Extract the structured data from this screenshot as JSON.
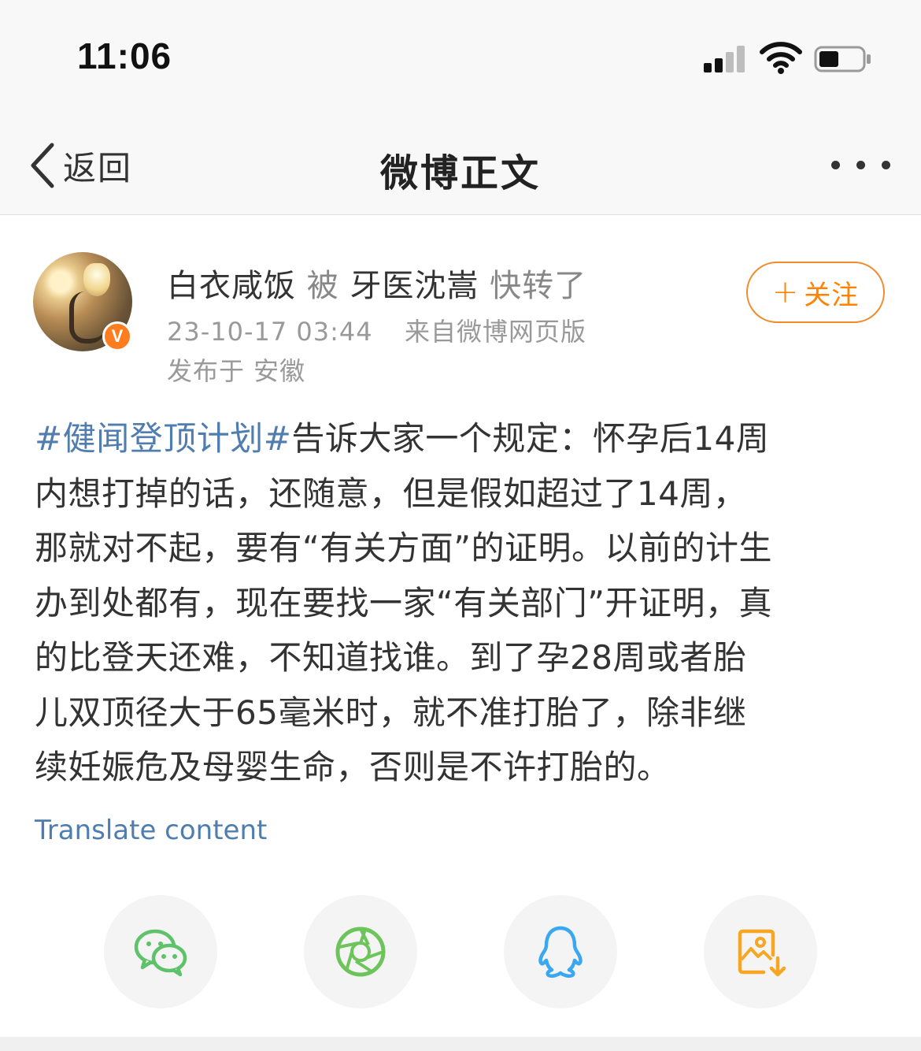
{
  "status_bar": {
    "time": "11:06"
  },
  "nav": {
    "back_label": "返回",
    "title": "微博正文"
  },
  "post": {
    "author": "白衣咸饭",
    "repost_by_word": "被",
    "reposter": "牙医沈嵩",
    "repost_action": "快转了",
    "timestamp": "23-10-17 03:44",
    "source": "来自微博网页版",
    "location": "发布于 安徽",
    "follow_plus": "+",
    "follow_label": "关注",
    "verified_badge": "V",
    "hashtag": "#健闻登顶计划#",
    "body_lines": [
      "告诉大家一个规定：怀孕后14周",
      "内想打掉的话，还随意，但是假如超过了14周，",
      "那就对不起，要有“有关方面”的证明。以前的计生",
      "办到处都有，现在要找一家“有关部门”开证明，真",
      "的比登天还难，不知道找谁。到了孕28周或者胎",
      "儿双顶径大于65毫米时，就不准打胎了，除非继",
      "续妊娠危及母婴生命，否则是不许打胎的。"
    ],
    "translate_label": "Translate content"
  },
  "share": {
    "icons": [
      "wechat-icon",
      "moments-icon",
      "qq-icon",
      "save-image-icon"
    ],
    "colors": {
      "wechat": "#5ec26a",
      "moments": "#6dc45a",
      "qq": "#3aa8f0",
      "save": "#f5a623"
    }
  },
  "colors": {
    "link": "#507daf",
    "follow": "#ff8200",
    "badge": "#ff7c1f"
  }
}
